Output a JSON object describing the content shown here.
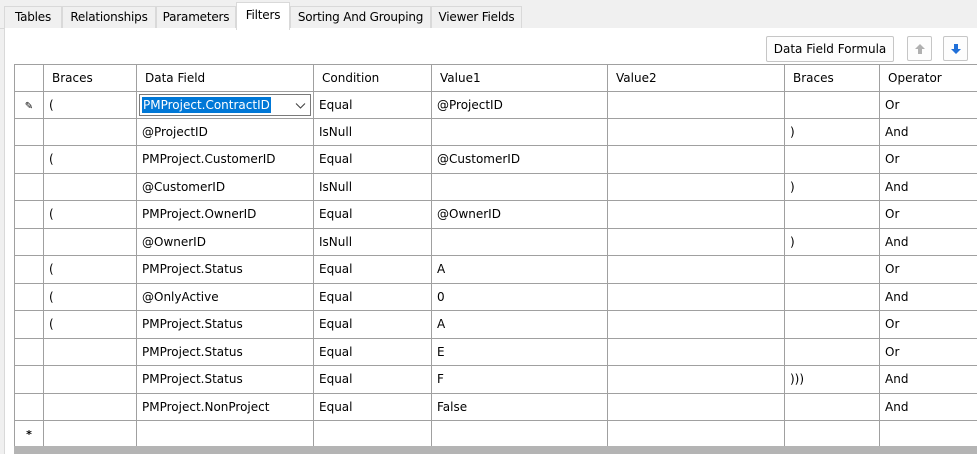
{
  "tabs": [
    {
      "label": "Tables",
      "active": false
    },
    {
      "label": "Relationships",
      "active": false
    },
    {
      "label": "Parameters",
      "active": false
    },
    {
      "label": "Filters",
      "active": true
    },
    {
      "label": "Sorting And Grouping",
      "active": false
    },
    {
      "label": "Viewer Fields",
      "active": false
    }
  ],
  "toolbar": {
    "formula_label": "Data Field Formula",
    "up_icon": "arrow-up-icon",
    "down_icon": "arrow-down-icon",
    "down_color": "#1f6fd8",
    "up_color": "#b0b0b0"
  },
  "grid": {
    "columns": [
      "Braces",
      "Data Field",
      "Condition",
      "Value1",
      "Value2",
      "Braces",
      "Operator"
    ],
    "edit_glyph": "✎",
    "new_row_glyph": "*",
    "rows": [
      {
        "braces_open": "(",
        "data_field": "PMProject.ContractID",
        "condition": "Equal",
        "value1": "@ProjectID",
        "value2": "",
        "braces_close": "",
        "operator": "Or"
      },
      {
        "braces_open": "",
        "data_field": "@ProjectID",
        "condition": "IsNull",
        "value1": "",
        "value2": "",
        "braces_close": ")",
        "operator": "And"
      },
      {
        "braces_open": "(",
        "data_field": "PMProject.CustomerID",
        "condition": "Equal",
        "value1": "@CustomerID",
        "value2": "",
        "braces_close": "",
        "operator": "Or"
      },
      {
        "braces_open": "",
        "data_field": "@CustomerID",
        "condition": "IsNull",
        "value1": "",
        "value2": "",
        "braces_close": ")",
        "operator": "And"
      },
      {
        "braces_open": "(",
        "data_field": "PMProject.OwnerID",
        "condition": "Equal",
        "value1": "@OwnerID",
        "value2": "",
        "braces_close": "",
        "operator": "Or"
      },
      {
        "braces_open": "",
        "data_field": "@OwnerID",
        "condition": "IsNull",
        "value1": "",
        "value2": "",
        "braces_close": ")",
        "operator": "And"
      },
      {
        "braces_open": "(",
        "data_field": "PMProject.Status",
        "condition": "Equal",
        "value1": "A",
        "value2": "",
        "braces_close": "",
        "operator": "Or"
      },
      {
        "braces_open": "(",
        "data_field": "@OnlyActive",
        "condition": "Equal",
        "value1": "0",
        "value2": "",
        "braces_close": "",
        "operator": "And"
      },
      {
        "braces_open": "(",
        "data_field": "PMProject.Status",
        "condition": "Equal",
        "value1": "A",
        "value2": "",
        "braces_close": "",
        "operator": "Or"
      },
      {
        "braces_open": "",
        "data_field": "PMProject.Status",
        "condition": "Equal",
        "value1": "E",
        "value2": "",
        "braces_close": "",
        "operator": "Or"
      },
      {
        "braces_open": "",
        "data_field": "PMProject.Status",
        "condition": "Equal",
        "value1": "F",
        "value2": "",
        "braces_close": ")))",
        "operator": "And"
      },
      {
        "braces_open": "",
        "data_field": "PMProject.NonProject",
        "condition": "Equal",
        "value1": "False",
        "value2": "",
        "braces_close": "",
        "operator": "And"
      }
    ]
  }
}
